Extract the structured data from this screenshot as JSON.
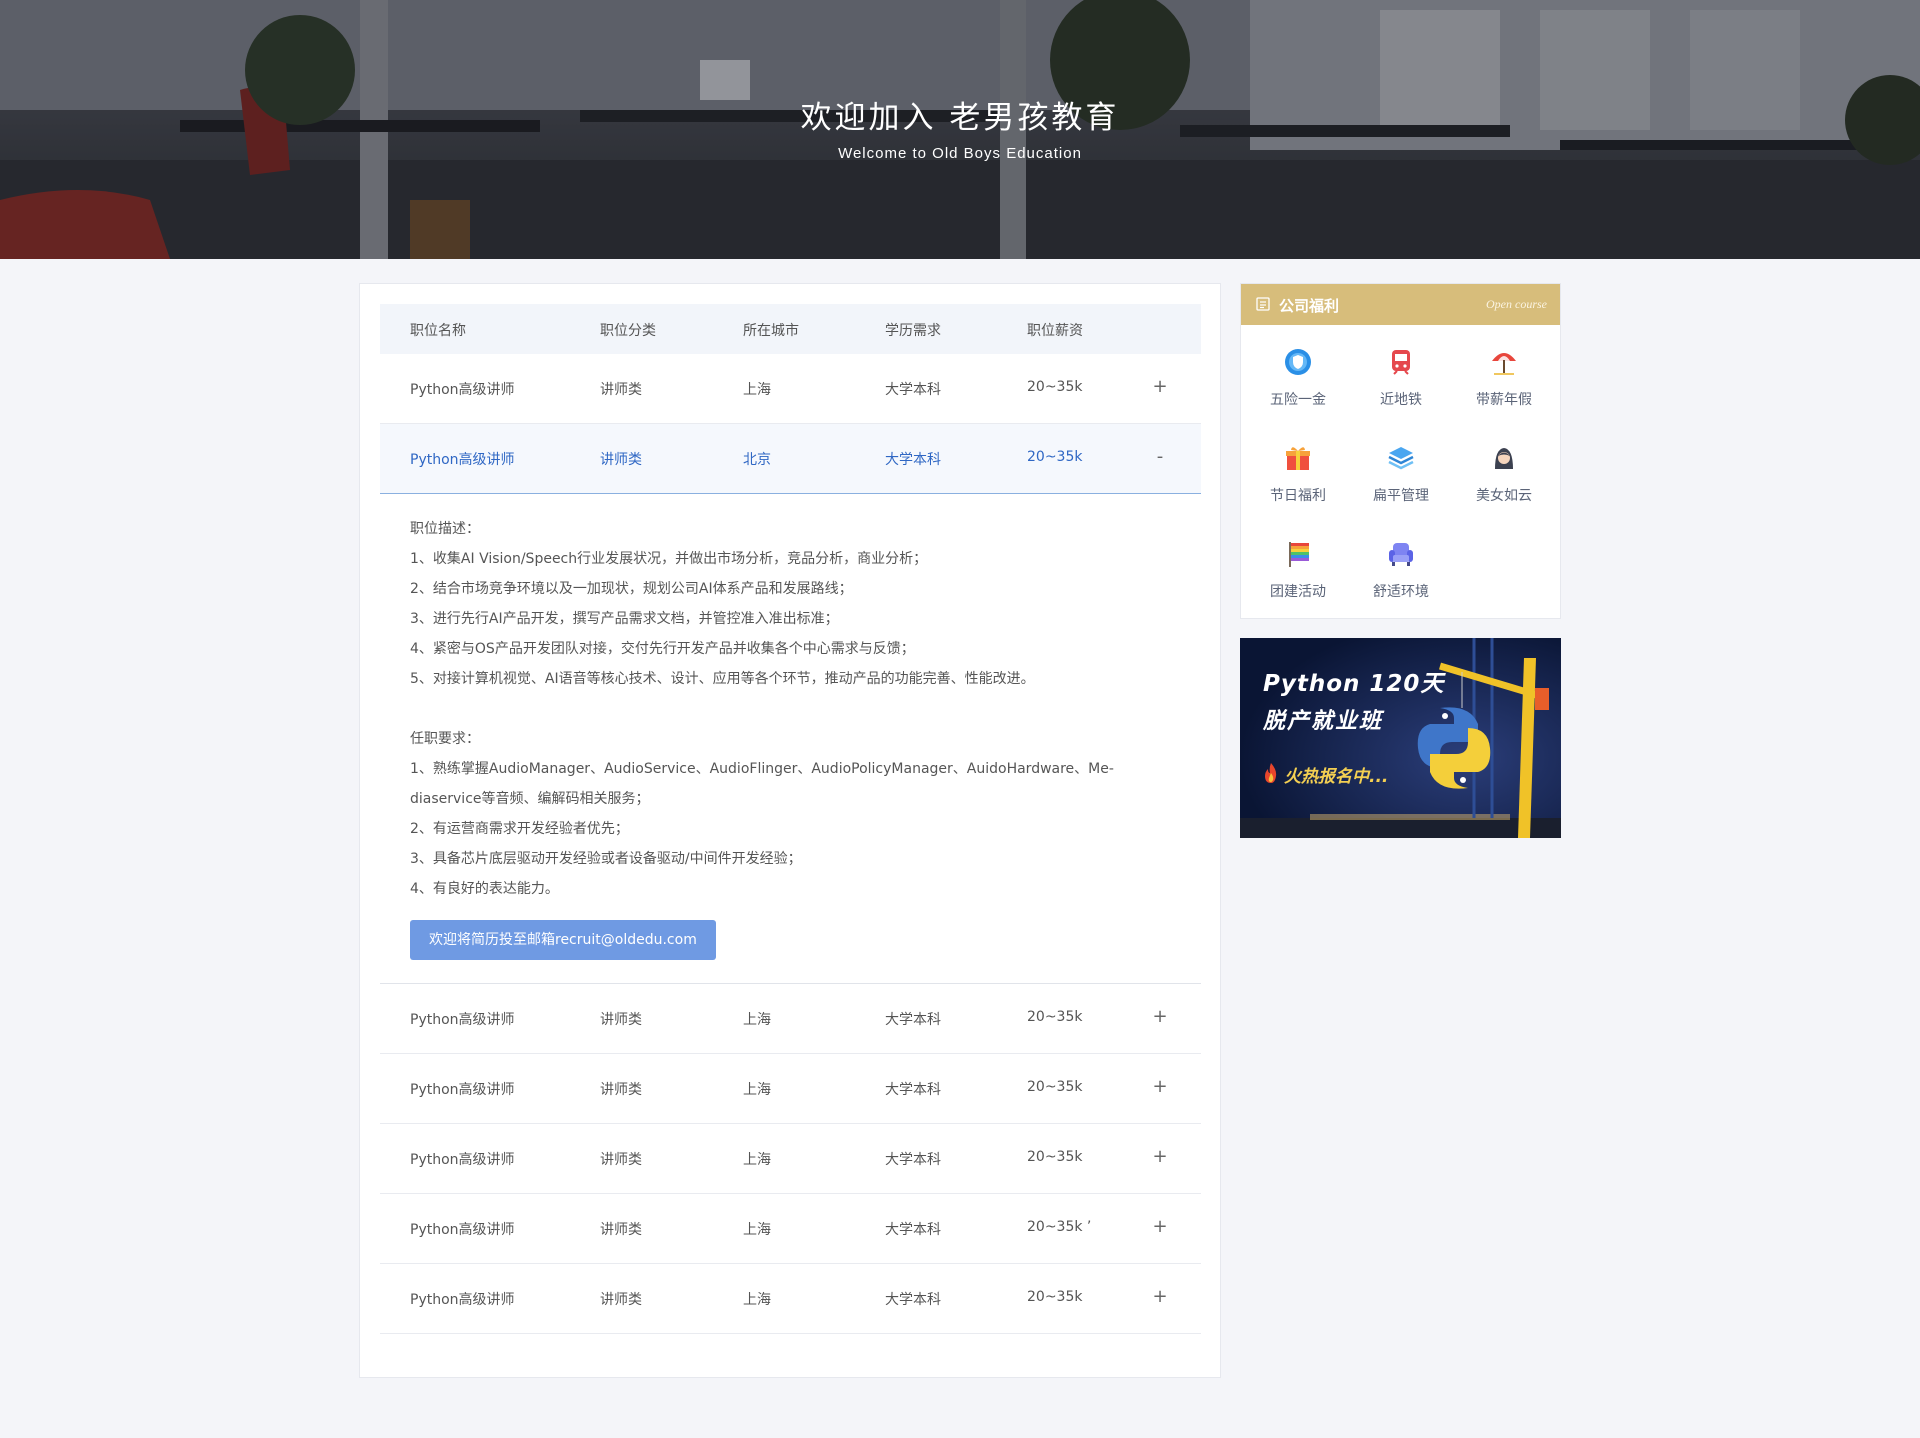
{
  "hero": {
    "title": "欢迎加入  老男孩教育",
    "subtitle": "Welcome to Old Boys Education"
  },
  "jobs": {
    "headers": [
      "职位名称",
      "职位分类",
      "所在城市",
      "学历需求",
      "职位薪资"
    ],
    "rows_before": [
      {
        "name": "Python高级讲师",
        "category": "讲师类",
        "city": "上海",
        "education": "大学本科",
        "salary": "20~35k",
        "toggle": "+"
      }
    ],
    "active": {
      "name": "Python高级讲师",
      "category": "讲师类",
      "city": "北京",
      "education": "大学本科",
      "salary": "20~35k",
      "toggle": "-"
    },
    "detail": {
      "desc_title": "职位描述：",
      "desc_items": [
        "1、收集AI Vision/Speech行业发展状况，并做出市场分析，竞品分析，商业分析；",
        "2、结合市场竞争环境以及一加现状，规划公司AI体系产品和发展路线；",
        "3、进行先行AI产品开发，撰写产品需求文档，并管控准入准出标准；",
        "4、紧密与OS产品开发团队对接，交付先行开发产品并收集各个中心需求与反馈；",
        "5、对接计算机视觉、AI语音等核心技术、设计、应用等各个环节，推动产品的功能完善、性能改进。"
      ],
      "req_title": "任职要求：",
      "req_items": [
        "1、熟练掌握AudioManager、AudioService、AudioFlinger、AudioPolicyManager、AuidoHardware、Me-",
        "diaservice等音频、编解码相关服务；",
        "2、有运营商需求开发经验者优先；",
        "3、具备芯片底层驱动开发经验或者设备驱动/中间件开发经验；",
        "4、有良好的表达能力。"
      ],
      "apply_label": "欢迎将简历投至邮箱recruit@oldedu.com"
    },
    "rows_after": [
      {
        "name": "Python高级讲师",
        "category": "讲师类",
        "city": "上海",
        "education": "大学本科",
        "salary": "20~35k",
        "toggle": "+"
      },
      {
        "name": "Python高级讲师",
        "category": "讲师类",
        "city": "上海",
        "education": "大学本科",
        "salary": "20~35k",
        "toggle": "+"
      },
      {
        "name": "Python高级讲师",
        "category": "讲师类",
        "city": "上海",
        "education": "大学本科",
        "salary": "20~35k",
        "toggle": "+"
      },
      {
        "name": "Python高级讲师",
        "category": "讲师类",
        "city": "上海",
        "education": "大学本科",
        "salary": "20~35k ’",
        "toggle": "+"
      },
      {
        "name": "Python高级讲师",
        "category": "讲师类",
        "city": "上海",
        "education": "大学本科",
        "salary": "20~35k",
        "toggle": "+"
      }
    ]
  },
  "benefits": {
    "title": "公司福利",
    "subtitle": "Open course",
    "items": [
      {
        "label": "五险一金",
        "icon": "shield-icon"
      },
      {
        "label": "近地铁",
        "icon": "subway-icon"
      },
      {
        "label": "带薪年假",
        "icon": "beach-umbrella-icon"
      },
      {
        "label": "节日福利",
        "icon": "gift-icon"
      },
      {
        "label": "扁平管理",
        "icon": "layers-icon"
      },
      {
        "label": "美女如云",
        "icon": "woman-icon"
      },
      {
        "label": "团建活动",
        "icon": "flag-icon"
      },
      {
        "label": "舒适环境",
        "icon": "armchair-icon"
      }
    ]
  },
  "promo": {
    "line1": "Python 120天",
    "line2": "脱产就业班",
    "line3": "火热报名中..."
  },
  "colors": {
    "accent_gold": "#d7bd7b",
    "link_blue": "#2f67c4",
    "button_blue": "#6f9ae3"
  }
}
